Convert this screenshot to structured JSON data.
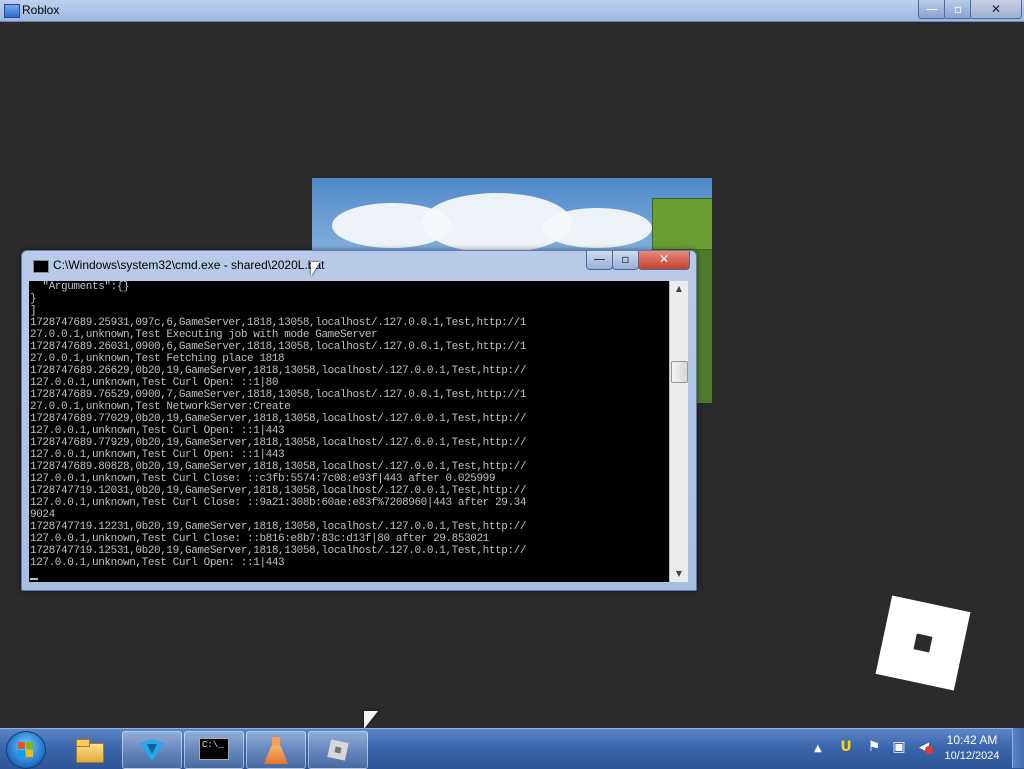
{
  "roblox_window": {
    "title": "Roblox",
    "controls": {
      "minimize": "—",
      "maximize": "▫",
      "close": "✕"
    }
  },
  "cmd_window": {
    "title": "C:\\Windows\\system32\\cmd.exe - shared\\2020L.bat",
    "controls": {
      "minimize": "—",
      "maximize": "▫",
      "close": "✕"
    },
    "lines": [
      "  \"Arguments\":{}",
      "}",
      "]",
      "1728747689.25931,097c,6,GameServer,1818,13058,localhost/.127.0.0.1,Test,http://1",
      "27.0.0.1,unknown,Test Executing job with mode GameServer",
      "1728747689.26031,0900,6,GameServer,1818,13058,localhost/.127.0.0.1,Test,http://1",
      "27.0.0.1,unknown,Test Fetching place 1818",
      "1728747689.26629,0b20,19,GameServer,1818,13058,localhost/.127.0.0.1,Test,http://",
      "127.0.0.1,unknown,Test Curl Open: ::1|80",
      "1728747689.76529,0900,7,GameServer,1818,13058,localhost/.127.0.0.1,Test,http://1",
      "27.0.0.1,unknown,Test NetworkServer:Create",
      "1728747689.77029,0b20,19,GameServer,1818,13058,localhost/.127.0.0.1,Test,http://",
      "127.0.0.1,unknown,Test Curl Open: ::1|443",
      "1728747689.77929,0b20,19,GameServer,1818,13058,localhost/.127.0.0.1,Test,http://",
      "127.0.0.1,unknown,Test Curl Open: ::1|443",
      "1728747689.80828,0b20,19,GameServer,1818,13058,localhost/.127.0.0.1,Test,http://",
      "127.0.0.1,unknown,Test Curl Close: ::c3fb:5574:7c08:e93f|443 after 0.025999",
      "1728747719.12031,0b20,19,GameServer,1818,13058,localhost/.127.0.0.1,Test,http://",
      "127.0.0.1,unknown,Test Curl Close: ::9a21:308b:60ae:e83f%7208960|443 after 29.34",
      "9024",
      "1728747719.12231,0b20,19,GameServer,1818,13058,localhost/.127.0.0.1,Test,http://",
      "127.0.0.1,unknown,Test Curl Close: ::b816:e8b7:83c:d13f|80 after 29.853021",
      "1728747719.12531,0b20,19,GameServer,1818,13058,localhost/.127.0.0.1,Test,http://",
      "127.0.0.1,unknown,Test Curl Open: ::1|443"
    ],
    "cursor": "_"
  },
  "taskbar": {
    "buttons": [
      {
        "name": "explorer",
        "icon": "folder-icon",
        "active": false
      },
      {
        "name": "vs-code",
        "icon": "code-editor-icon",
        "active": true
      },
      {
        "name": "cmd",
        "icon": "command-prompt-icon",
        "active": true
      },
      {
        "name": "flask-app",
        "icon": "flask-icon",
        "active": true
      },
      {
        "name": "roblox",
        "icon": "roblox-icon",
        "active": true
      }
    ],
    "cmd_glyph": "C:\\_",
    "clock": {
      "time": "10:42 AM",
      "date": "10/12/2024"
    },
    "tray_icons": [
      "show-hidden-icon",
      "language-icon",
      "flag-icon",
      "network-icon",
      "volume-muted-icon"
    ]
  },
  "colors": {
    "desktop": "#2b2b2b",
    "console_bg": "#000000",
    "console_fg": "#c0c0c0",
    "taskbar": "#3b66ad"
  }
}
